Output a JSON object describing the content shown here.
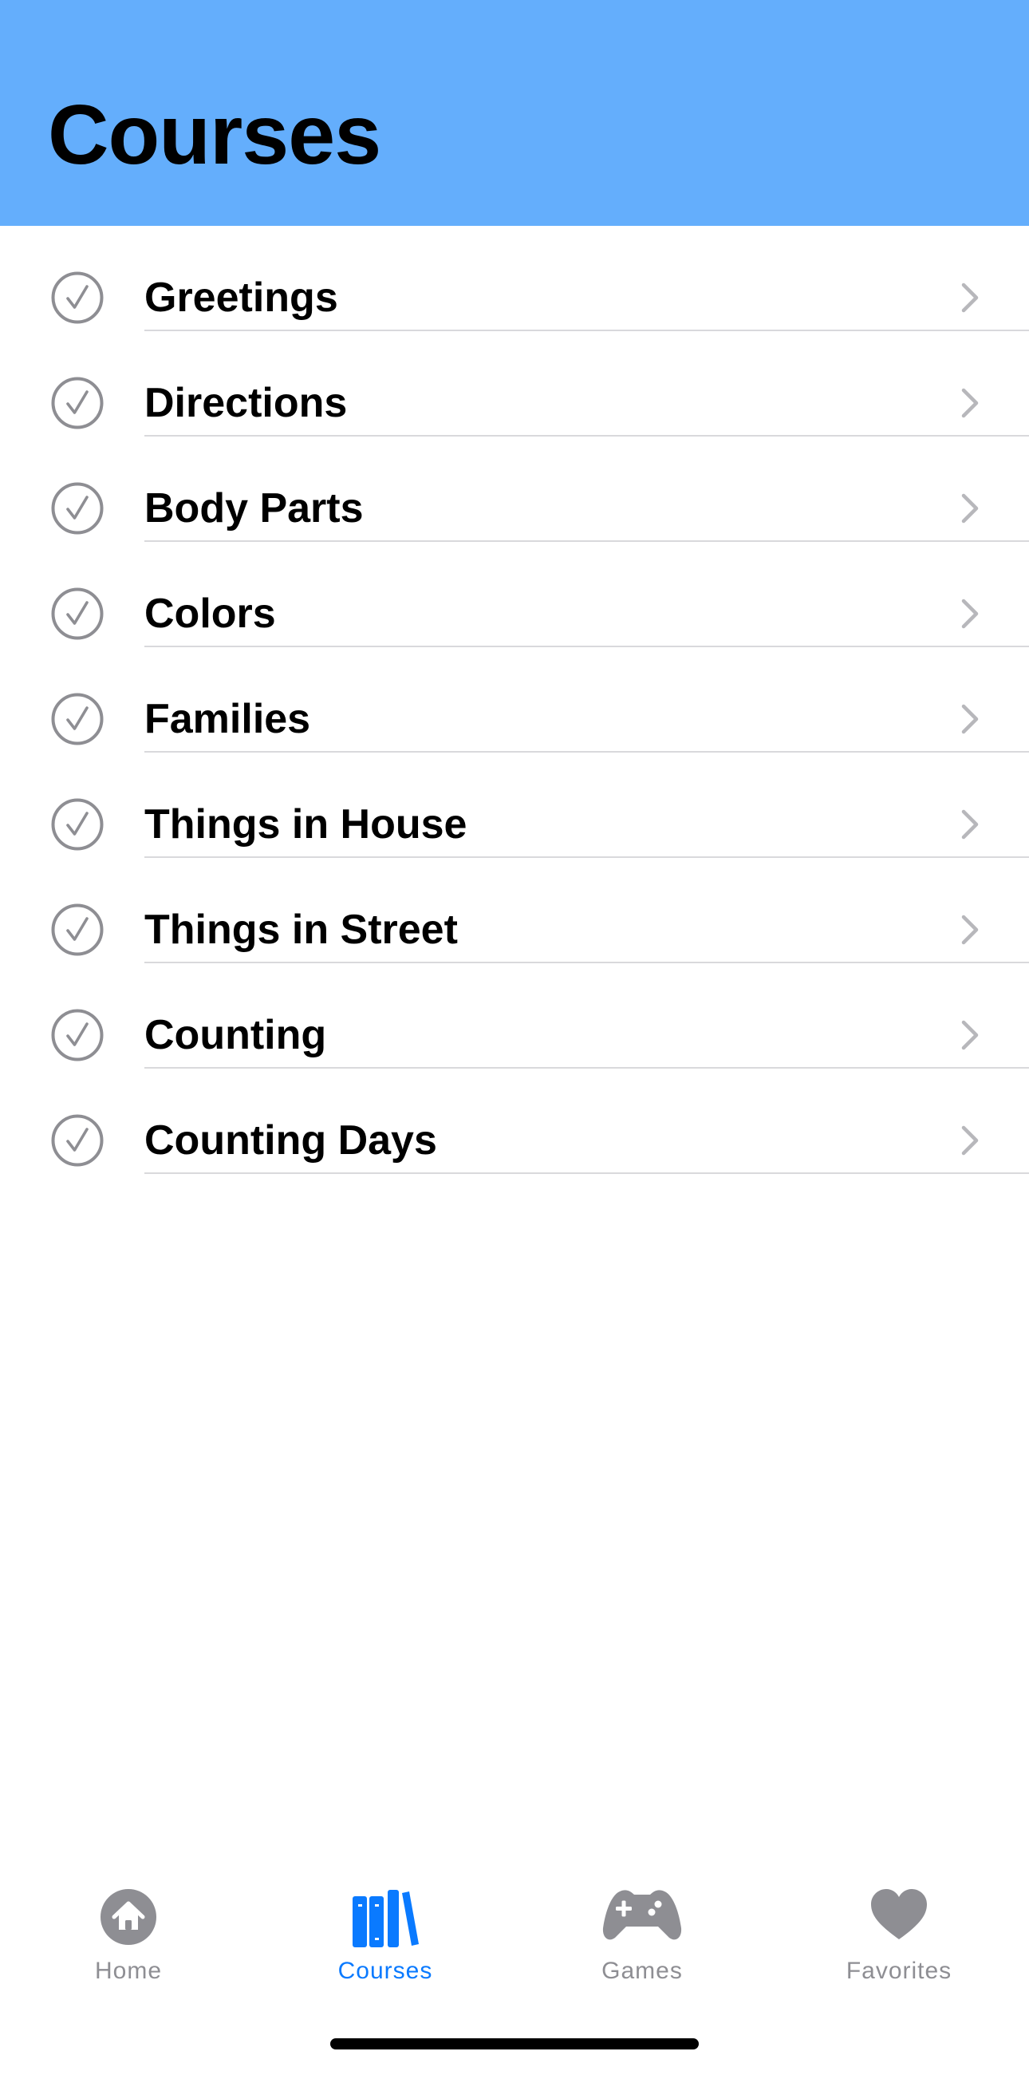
{
  "header": {
    "title": "Courses",
    "background_color": "#64aefc"
  },
  "courses": {
    "items": [
      {
        "label": "Greetings",
        "status_icon": "checkmark-circle-icon"
      },
      {
        "label": "Directions",
        "status_icon": "checkmark-circle-icon"
      },
      {
        "label": "Body Parts",
        "status_icon": "checkmark-circle-icon"
      },
      {
        "label": "Colors",
        "status_icon": "checkmark-circle-icon"
      },
      {
        "label": "Families",
        "status_icon": "checkmark-circle-icon"
      },
      {
        "label": "Things in House",
        "status_icon": "checkmark-circle-icon"
      },
      {
        "label": "Things in Street",
        "status_icon": "checkmark-circle-icon"
      },
      {
        "label": "Counting",
        "status_icon": "checkmark-circle-icon"
      },
      {
        "label": "Counting Days",
        "status_icon": "checkmark-circle-icon"
      }
    ]
  },
  "tab_bar": {
    "active_color": "#0a7aff",
    "inactive_color": "#8e8e93",
    "tabs": [
      {
        "label": "Home",
        "icon": "house-icon",
        "active": false
      },
      {
        "label": "Courses",
        "icon": "books-icon",
        "active": true
      },
      {
        "label": "Games",
        "icon": "gamecontroller-icon",
        "active": false
      },
      {
        "label": "Favorites",
        "icon": "heart-icon",
        "active": false
      }
    ]
  }
}
